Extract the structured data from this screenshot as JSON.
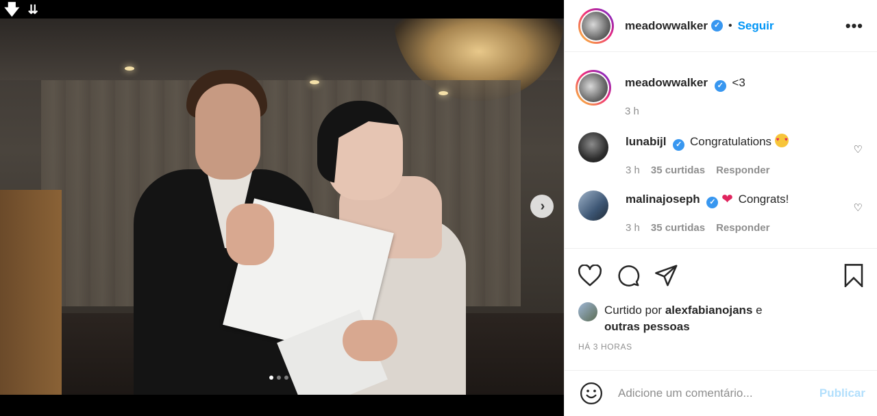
{
  "post": {
    "username": "meadowwalker",
    "follow_label": "Seguir",
    "bullet": "•",
    "more_label": "•••"
  },
  "comments": [
    {
      "user": "meadowwalker",
      "text": "<3",
      "time": "3 h",
      "likes": "",
      "reply": "",
      "avatar": "bw"
    },
    {
      "user": "lunabijl",
      "text": "Congratulations",
      "emoji": "smiling-face-with-hearts",
      "time": "3 h",
      "likes": "35 curtidas",
      "reply": "Responder",
      "avatar": "dark"
    },
    {
      "user": "malinajoseph",
      "emoji_before": "red-heart",
      "text": "Congrats!",
      "time": "3 h",
      "likes": "35 curtidas",
      "reply": "Responder",
      "avatar": "blue"
    }
  ],
  "likes": {
    "prefix": "Curtido por",
    "user": "alexfabianojans",
    "conj": "e",
    "others": "outras pessoas"
  },
  "timestamp": "HÁ 3 HORAS",
  "composer": {
    "placeholder": "Adicione um comentário...",
    "post_label": "Publicar"
  },
  "carousel": {
    "count": 3,
    "active": 0
  },
  "colors": {
    "accent": "#0095f6",
    "verified": "#3897f0",
    "heart": "#e0245e",
    "post_disabled": "#b2dffc"
  }
}
